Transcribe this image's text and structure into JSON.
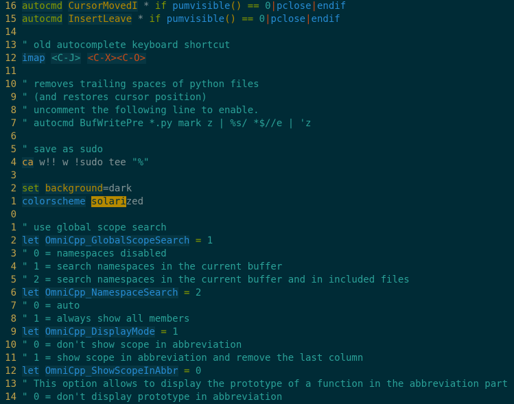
{
  "cursor_line_index": 16,
  "lines": [
    {
      "rel": "16",
      "tokens": [
        {
          "cls": "k-autocmd hl",
          "t": "autocmd"
        },
        {
          "cls": "plain",
          "t": " "
        },
        {
          "cls": "event hl",
          "t": "CursorMovedI"
        },
        {
          "cls": "plain",
          "t": " * "
        },
        {
          "cls": "k-cond",
          "t": "if"
        },
        {
          "cls": "plain",
          "t": " "
        },
        {
          "cls": "fn",
          "t": "pumvisible"
        },
        {
          "cls": "paren",
          "t": "()"
        },
        {
          "cls": "plain",
          "t": " "
        },
        {
          "cls": "op",
          "t": "=="
        },
        {
          "cls": "plain",
          "t": " "
        },
        {
          "cls": "num",
          "t": "0"
        },
        {
          "cls": "pipe",
          "t": "|"
        },
        {
          "cls": "k-pclose",
          "t": "pclose"
        },
        {
          "cls": "pipe",
          "t": "|"
        },
        {
          "cls": "k-end",
          "t": "endif"
        }
      ]
    },
    {
      "rel": "15",
      "tokens": [
        {
          "cls": "k-autocmd hl",
          "t": "autocmd"
        },
        {
          "cls": "plain",
          "t": " "
        },
        {
          "cls": "event hl",
          "t": "InsertLeave"
        },
        {
          "cls": "plain",
          "t": " * "
        },
        {
          "cls": "k-cond",
          "t": "if"
        },
        {
          "cls": "plain",
          "t": " "
        },
        {
          "cls": "fn",
          "t": "pumvisible"
        },
        {
          "cls": "paren",
          "t": "()"
        },
        {
          "cls": "plain",
          "t": " "
        },
        {
          "cls": "op",
          "t": "=="
        },
        {
          "cls": "plain",
          "t": " "
        },
        {
          "cls": "num",
          "t": "0"
        },
        {
          "cls": "pipe",
          "t": "|"
        },
        {
          "cls": "k-pclose",
          "t": "pclose"
        },
        {
          "cls": "pipe",
          "t": "|"
        },
        {
          "cls": "k-end",
          "t": "endif"
        }
      ]
    },
    {
      "rel": "14",
      "tokens": []
    },
    {
      "rel": "13",
      "tokens": [
        {
          "cls": "cmt",
          "t": "\" old autocomplete keyboard shortcut"
        }
      ]
    },
    {
      "rel": "12",
      "tokens": [
        {
          "cls": "k-imap hl",
          "t": "imap"
        },
        {
          "cls": "plain",
          "t": " "
        },
        {
          "cls": "map-lhs",
          "t": "<C-J>"
        },
        {
          "cls": "plain",
          "t": " "
        },
        {
          "cls": "map-rhs",
          "t": "<C-X><C-O>"
        }
      ]
    },
    {
      "rel": "11",
      "tokens": []
    },
    {
      "rel": "10",
      "tokens": [
        {
          "cls": "cmt",
          "t": "\" removes trailing spaces of python files"
        }
      ]
    },
    {
      "rel": "9",
      "tokens": [
        {
          "cls": "cmt",
          "t": "\" (and restores cursor position)"
        }
      ]
    },
    {
      "rel": "8",
      "tokens": [
        {
          "cls": "cmt",
          "t": "\" uncomment the following line to enable."
        }
      ]
    },
    {
      "rel": "7",
      "tokens": [
        {
          "cls": "cmt",
          "t": "\" autocmd BufWritePre *.py mark z | %s/ *$//e | 'z"
        }
      ]
    },
    {
      "rel": "6",
      "tokens": []
    },
    {
      "rel": "5",
      "tokens": [
        {
          "cls": "cmt",
          "t": "\" save as sudo"
        }
      ]
    },
    {
      "rel": "4",
      "tokens": [
        {
          "cls": "k-ca hl",
          "t": "ca"
        },
        {
          "cls": "plain",
          "t": " w!! w !sudo tee "
        },
        {
          "cls": "str",
          "t": "\"%\""
        }
      ]
    },
    {
      "rel": "3",
      "tokens": []
    },
    {
      "rel": "2",
      "tokens": [
        {
          "cls": "k-set hl",
          "t": "set"
        },
        {
          "cls": "plain",
          "t": " "
        },
        {
          "cls": "opt hl",
          "t": "background"
        },
        {
          "cls": "plain",
          "t": "=dark"
        }
      ]
    },
    {
      "rel": "1",
      "tokens": [
        {
          "cls": "k-cs hl",
          "t": "colorscheme"
        },
        {
          "cls": "plain",
          "t": " "
        },
        {
          "cls": "cursor",
          "t": "solari"
        },
        {
          "cls": "plain",
          "t": "zed"
        }
      ]
    },
    {
      "rel": "0",
      "tokens": []
    },
    {
      "rel": "1",
      "tokens": [
        {
          "cls": "cmt",
          "t": "\" use global scope search"
        }
      ]
    },
    {
      "rel": "2",
      "tokens": [
        {
          "cls": "k-let hl",
          "t": "let"
        },
        {
          "cls": "plain",
          "t": " "
        },
        {
          "cls": "ident hl",
          "t": "OmniCpp_GlobalScopeSearch"
        },
        {
          "cls": "plain",
          "t": " "
        },
        {
          "cls": "op",
          "t": "="
        },
        {
          "cls": "plain",
          "t": " "
        },
        {
          "cls": "num",
          "t": "1"
        }
      ]
    },
    {
      "rel": "3",
      "tokens": [
        {
          "cls": "cmt",
          "t": "\" 0 = namespaces disabled"
        }
      ]
    },
    {
      "rel": "4",
      "tokens": [
        {
          "cls": "cmt",
          "t": "\" 1 = search namespaces in the current buffer"
        }
      ]
    },
    {
      "rel": "5",
      "tokens": [
        {
          "cls": "cmt",
          "t": "\" 2 = search namespaces in the current buffer and in included files"
        }
      ]
    },
    {
      "rel": "6",
      "tokens": [
        {
          "cls": "k-let hl",
          "t": "let"
        },
        {
          "cls": "plain",
          "t": " "
        },
        {
          "cls": "ident hl",
          "t": "OmniCpp_NamespaceSearch"
        },
        {
          "cls": "plain",
          "t": " "
        },
        {
          "cls": "op",
          "t": "="
        },
        {
          "cls": "plain",
          "t": " "
        },
        {
          "cls": "num",
          "t": "2"
        }
      ]
    },
    {
      "rel": "7",
      "tokens": [
        {
          "cls": "cmt",
          "t": "\" 0 = auto"
        }
      ]
    },
    {
      "rel": "8",
      "tokens": [
        {
          "cls": "cmt",
          "t": "\" 1 = always show all members"
        }
      ]
    },
    {
      "rel": "9",
      "tokens": [
        {
          "cls": "k-let hl",
          "t": "let"
        },
        {
          "cls": "plain",
          "t": " "
        },
        {
          "cls": "ident hl",
          "t": "OmniCpp_DisplayMode"
        },
        {
          "cls": "plain",
          "t": " "
        },
        {
          "cls": "op",
          "t": "="
        },
        {
          "cls": "plain",
          "t": " "
        },
        {
          "cls": "num",
          "t": "1"
        }
      ]
    },
    {
      "rel": "10",
      "tokens": [
        {
          "cls": "cmt",
          "t": "\" 0 = don't show scope in abbreviation"
        }
      ]
    },
    {
      "rel": "11",
      "tokens": [
        {
          "cls": "cmt",
          "t": "\" 1 = show scope in abbreviation and remove the last column"
        }
      ]
    },
    {
      "rel": "12",
      "tokens": [
        {
          "cls": "k-let hl",
          "t": "let"
        },
        {
          "cls": "plain",
          "t": " "
        },
        {
          "cls": "ident hl",
          "t": "OmniCpp_ShowScopeInAbbr"
        },
        {
          "cls": "plain",
          "t": " "
        },
        {
          "cls": "op",
          "t": "="
        },
        {
          "cls": "plain",
          "t": " "
        },
        {
          "cls": "num",
          "t": "0"
        }
      ]
    },
    {
      "rel": "13",
      "tokens": [
        {
          "cls": "cmt",
          "t": "\" This option allows to display the prototype of a function in the abbreviation part of th"
        }
      ]
    },
    {
      "rel": "14",
      "tokens": [
        {
          "cls": "cmt",
          "t": "\" 0 = don't display prototype in abbreviation"
        }
      ]
    }
  ]
}
